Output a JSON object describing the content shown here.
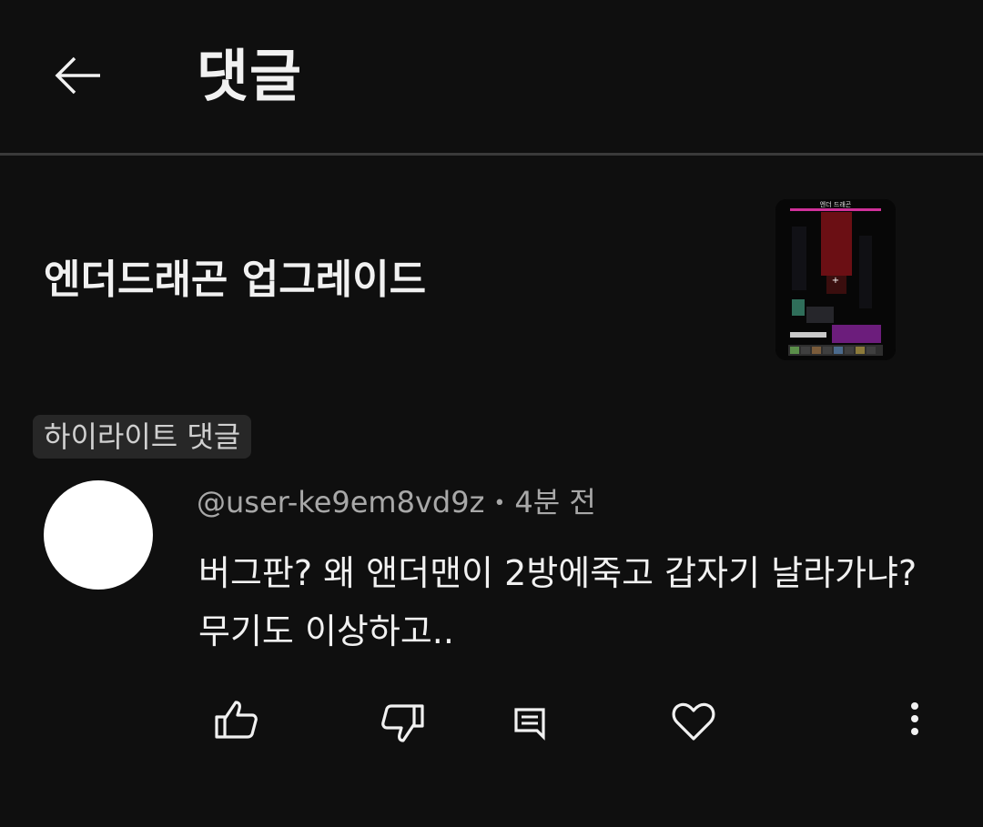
{
  "header": {
    "title": "댓글",
    "back_icon": "arrow-left-icon"
  },
  "video": {
    "title": "엔더드래곤 업그레이드",
    "thumbnail_caption": "엔더 드래곤"
  },
  "highlight_label": "하이라이트 댓글",
  "comment": {
    "author": "@user-ke9em8vd9z",
    "separator": "•",
    "time": "4분 전",
    "text_line1": "버그판?  왜 앤더맨이 2방에죽고 갑자기 날라가냐?",
    "text_line2": "무기도 이상하고.."
  },
  "actions": [
    "thumbs-up-icon",
    "thumbs-down-icon",
    "reply-icon",
    "heart-icon",
    "more-vert-icon"
  ],
  "colors": {
    "background": "#0f0f0f",
    "text": "#f1f1f1",
    "secondary_text": "#a8a8a8",
    "chip_bg": "#272727",
    "divider": "#3a3a3a"
  }
}
